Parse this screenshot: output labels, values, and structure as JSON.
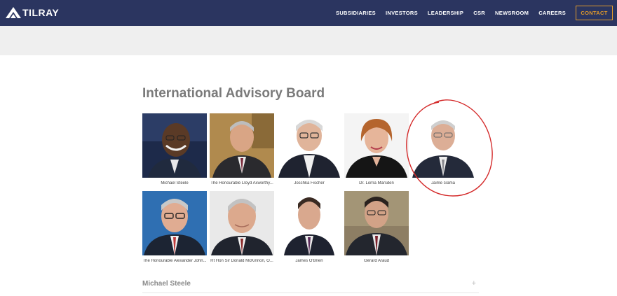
{
  "header": {
    "logo_text": "TILRAY",
    "nav": [
      "SUBSIDIARIES",
      "INVESTORS",
      "LEADERSHIP",
      "CSR",
      "NEWSROOM",
      "CAREERS"
    ],
    "contact_label": "CONTACT"
  },
  "page": {
    "title": "International Advisory Board"
  },
  "members": [
    {
      "name": "Michael Steele"
    },
    {
      "name": "The Honourable Lloyd Axworthy..."
    },
    {
      "name": "Joschka Fischer"
    },
    {
      "name": "Dr. Lorna Marsden"
    },
    {
      "name": "Jaime Gama"
    },
    {
      "name": "The Honourable Alexander John..."
    },
    {
      "name": "Rt Hon Sir Donald McKinnon, O..."
    },
    {
      "name": "James O'Brien"
    },
    {
      "name": "Gérard Araud"
    }
  ],
  "accordion": {
    "label": "Michael Steele",
    "toggle": "+"
  },
  "colors": {
    "header_bg": "#2b3560",
    "accent": "#e09a2b",
    "annotation": "#d42a2a"
  }
}
